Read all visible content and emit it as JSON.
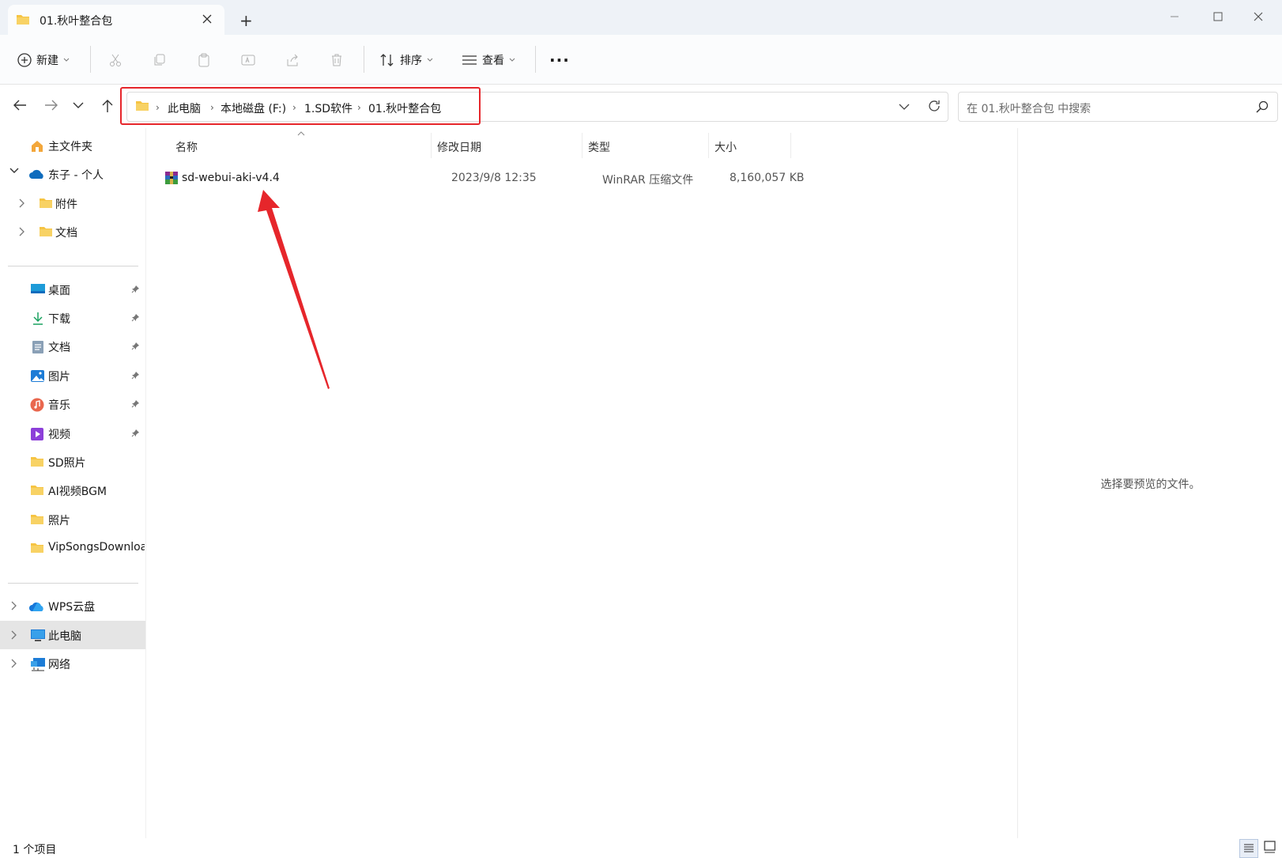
{
  "window": {
    "tab_title": "01.秋叶整合包",
    "new_tab": "+"
  },
  "toolbar": {
    "new_label": "新建",
    "sort_label": "排序",
    "view_label": "查看",
    "more": "···"
  },
  "address": {
    "crumbs": [
      "此电脑",
      "本地磁盘 (F:)",
      "1.SD软件",
      "01.秋叶整合包"
    ],
    "search_placeholder": "在 01.秋叶整合包 中搜索"
  },
  "sidebar": {
    "top": [
      {
        "label": "主文件夹",
        "icon": "home-icon"
      },
      {
        "label": "东子 - 个人",
        "icon": "onedrive-cloud-icon"
      },
      {
        "label": "附件",
        "icon": "folder-icon"
      },
      {
        "label": "文档",
        "icon": "folder-icon"
      }
    ],
    "quick": [
      {
        "label": "桌面",
        "icon": "desktop-icon"
      },
      {
        "label": "下载",
        "icon": "download-icon"
      },
      {
        "label": "文档",
        "icon": "document-icon"
      },
      {
        "label": "图片",
        "icon": "pictures-icon"
      },
      {
        "label": "音乐",
        "icon": "music-icon"
      },
      {
        "label": "视频",
        "icon": "video-icon"
      },
      {
        "label": "SD照片",
        "icon": "folder-icon"
      },
      {
        "label": "AI视频BGM",
        "icon": "folder-icon"
      },
      {
        "label": "照片",
        "icon": "folder-icon"
      },
      {
        "label": "VipSongsDownload",
        "icon": "folder-icon"
      }
    ],
    "bottom": [
      {
        "label": "WPS云盘",
        "icon": "wps-cloud-icon"
      },
      {
        "label": "此电脑",
        "icon": "computer-icon"
      },
      {
        "label": "网络",
        "icon": "network-icon"
      }
    ]
  },
  "columns": {
    "name": "名称",
    "date": "修改日期",
    "type": "类型",
    "size": "大小"
  },
  "files": [
    {
      "name": "sd-webui-aki-v4.4",
      "date": "2023/9/8 12:35",
      "type": "WinRAR 压缩文件",
      "size": "8,160,057 KB",
      "icon": "winrar-archive-icon"
    }
  ],
  "preview": {
    "message": "选择要预览的文件。"
  },
  "status": {
    "count": "1 个项目"
  },
  "colors": {
    "highlight_box": "#e6262b",
    "arrow": "#e6262b",
    "folder": "#f6c443",
    "tab_strip": "#eef2f7"
  }
}
